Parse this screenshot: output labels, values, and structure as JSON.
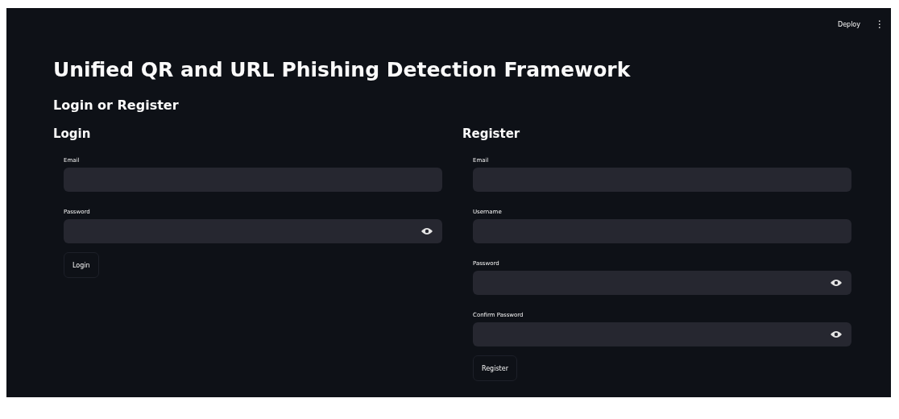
{
  "header": {
    "deploy": "Deploy",
    "menu": "⋮"
  },
  "title": "Unified QR and URL Phishing Detection Framework",
  "subtitle": "Login or Register",
  "forms": [
    {
      "heading": "Login",
      "fields": [
        {
          "label": "Email",
          "kind": "text"
        },
        {
          "label": "Password",
          "kind": "password"
        }
      ],
      "button": "Login"
    },
    {
      "heading": "Register",
      "fields": [
        {
          "label": "Email",
          "kind": "text"
        },
        {
          "label": "Username",
          "kind": "text"
        },
        {
          "label": "Password",
          "kind": "password"
        },
        {
          "label": "Confirm Password",
          "kind": "password"
        }
      ],
      "button": "Register"
    }
  ]
}
